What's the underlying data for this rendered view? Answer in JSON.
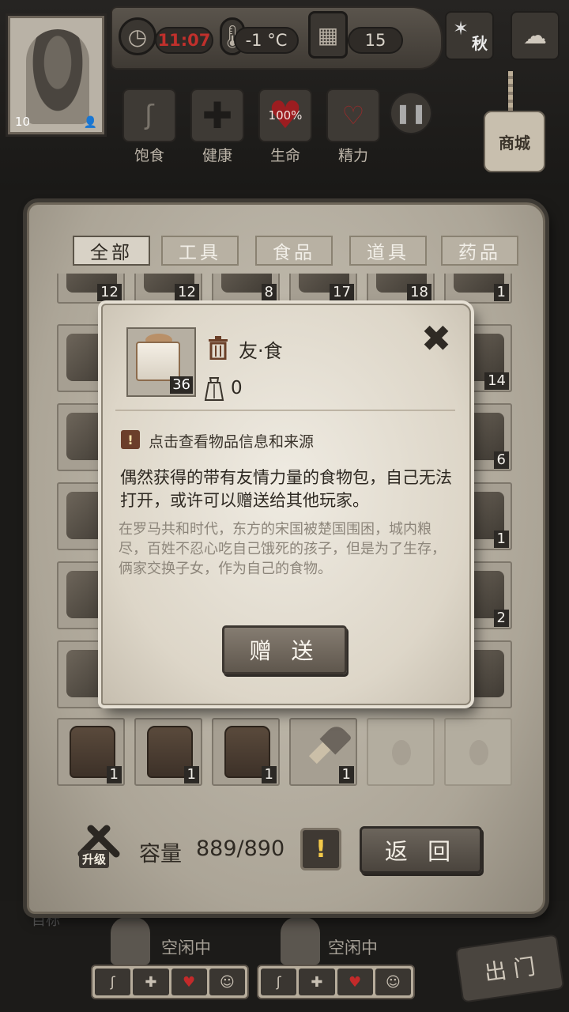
{
  "hud": {
    "level": "10",
    "time_value": "11:07",
    "temperature": "-1 °C",
    "day": "15",
    "season": "秋",
    "shop_label": "商城",
    "vitals": [
      {
        "label": "饱食",
        "icon": "stomach-icon"
      },
      {
        "label": "健康",
        "icon": "cross-icon"
      },
      {
        "label": "生命",
        "icon": "heart-icon",
        "value": "100%"
      },
      {
        "label": "精力",
        "icon": "brain-icon"
      }
    ]
  },
  "tabs": [
    "全部",
    "工具",
    "食品",
    "道具",
    "药品"
  ],
  "inventory": {
    "cells": [
      {
        "count": "12"
      },
      {
        "count": "12"
      },
      {
        "count": "8"
      },
      {
        "count": "17"
      },
      {
        "count": "18"
      },
      {
        "count": "1"
      },
      {
        "count": "14"
      },
      {
        "count": "6"
      },
      {
        "count": "1"
      },
      {
        "count": "2"
      },
      {
        "count": "1"
      },
      {
        "count": "1"
      },
      {
        "count": "1"
      },
      {
        "count": "1"
      }
    ],
    "capacity_label": "容量",
    "capacity_value": "889/890",
    "upgrade_label": "升级",
    "back_label": "返 回"
  },
  "modal": {
    "item_name": "友·食",
    "item_count": "36",
    "weight": "0",
    "hint": "点击查看物品信息和来源",
    "description": "偶然获得的带有友情力量的食物包，自己无法打开，或许可以赠送给其他玩家。",
    "lore": "在罗马共和时代，东方的宋国被楚国围困，城内粮尽，百姓不忍心吃自己饿死的孩子，但是为了生存，俩家交换子女，作为自己的食物。",
    "gift_label": "赠 送",
    "close_symbol": "✖"
  },
  "bottom": {
    "goal_label": "目标",
    "idle_1": "空闲中",
    "idle_2": "空闲中",
    "exit_label": "出 门"
  }
}
